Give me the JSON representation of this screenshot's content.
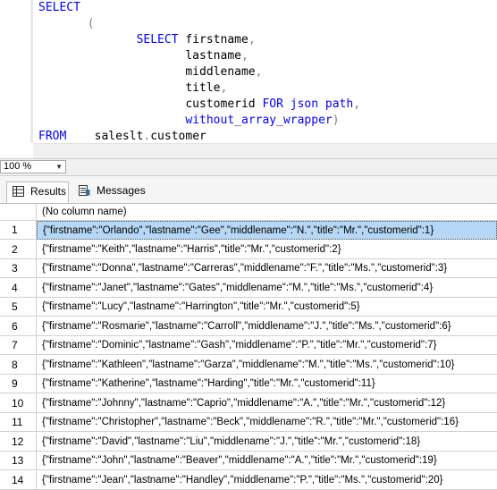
{
  "editor": {
    "lines": [
      [
        {
          "t": "SELECT",
          "c": "kw"
        }
      ],
      [
        {
          "t": "       (",
          "c": "gr"
        }
      ],
      [
        {
          "t": "              ",
          "c": "id"
        },
        {
          "t": "SELECT",
          "c": "kw"
        },
        {
          "t": " firstname",
          "c": "id"
        },
        {
          "t": ",",
          "c": "gr"
        }
      ],
      [
        {
          "t": "                     lastname",
          "c": "id"
        },
        {
          "t": ",",
          "c": "gr"
        }
      ],
      [
        {
          "t": "                     middlename",
          "c": "id"
        },
        {
          "t": ",",
          "c": "gr"
        }
      ],
      [
        {
          "t": "                     title",
          "c": "id"
        },
        {
          "t": ",",
          "c": "gr"
        }
      ],
      [
        {
          "t": "                     customerid ",
          "c": "id"
        },
        {
          "t": "FOR json path",
          "c": "kw"
        },
        {
          "t": ",",
          "c": "gr"
        }
      ],
      [
        {
          "t": "                     ",
          "c": "id"
        },
        {
          "t": "without_array_wrapper",
          "c": "kw"
        },
        {
          "t": ")",
          "c": "gr"
        }
      ],
      [
        {
          "t": "FROM",
          "c": "kw"
        },
        {
          "t": "    saleslt",
          "c": "id"
        },
        {
          "t": ".",
          "c": "gr"
        },
        {
          "t": "customer",
          "c": "id"
        }
      ]
    ]
  },
  "zoom": {
    "value": "100 %"
  },
  "tabs": {
    "results": "Results",
    "messages": "Messages"
  },
  "grid": {
    "column_header": "(No column name)",
    "rows": [
      {
        "n": "1",
        "v": "{\"firstname\":\"Orlando\",\"lastname\":\"Gee\",\"middlename\":\"N.\",\"title\":\"Mr.\",\"customerid\":1}",
        "selected": true
      },
      {
        "n": "2",
        "v": "{\"firstname\":\"Keith\",\"lastname\":\"Harris\",\"title\":\"Mr.\",\"customerid\":2}"
      },
      {
        "n": "3",
        "v": "{\"firstname\":\"Donna\",\"lastname\":\"Carreras\",\"middlename\":\"F.\",\"title\":\"Ms.\",\"customerid\":3}"
      },
      {
        "n": "4",
        "v": "{\"firstname\":\"Janet\",\"lastname\":\"Gates\",\"middlename\":\"M.\",\"title\":\"Ms.\",\"customerid\":4}"
      },
      {
        "n": "5",
        "v": "{\"firstname\":\"Lucy\",\"lastname\":\"Harrington\",\"title\":\"Mr.\",\"customerid\":5}"
      },
      {
        "n": "6",
        "v": "{\"firstname\":\"Rosmarie\",\"lastname\":\"Carroll\",\"middlename\":\"J.\",\"title\":\"Ms.\",\"customerid\":6}"
      },
      {
        "n": "7",
        "v": "{\"firstname\":\"Dominic\",\"lastname\":\"Gash\",\"middlename\":\"P.\",\"title\":\"Mr.\",\"customerid\":7}"
      },
      {
        "n": "8",
        "v": "{\"firstname\":\"Kathleen\",\"lastname\":\"Garza\",\"middlename\":\"M.\",\"title\":\"Ms.\",\"customerid\":10}"
      },
      {
        "n": "9",
        "v": "{\"firstname\":\"Katherine\",\"lastname\":\"Harding\",\"title\":\"Mr.\",\"customerid\":11}"
      },
      {
        "n": "10",
        "v": "{\"firstname\":\"Johnny\",\"lastname\":\"Caprio\",\"middlename\":\"A.\",\"title\":\"Mr.\",\"customerid\":12}"
      },
      {
        "n": "11",
        "v": "{\"firstname\":\"Christopher\",\"lastname\":\"Beck\",\"middlename\":\"R.\",\"title\":\"Mr.\",\"customerid\":16}"
      },
      {
        "n": "12",
        "v": "{\"firstname\":\"David\",\"lastname\":\"Liu\",\"middlename\":\"J.\",\"title\":\"Mr.\",\"customerid\":18}"
      },
      {
        "n": "13",
        "v": "{\"firstname\":\"John\",\"lastname\":\"Beaver\",\"middlename\":\"A.\",\"title\":\"Mr.\",\"customerid\":19}"
      },
      {
        "n": "14",
        "v": "{\"firstname\":\"Jean\",\"lastname\":\"Handley\",\"middlename\":\"P.\",\"title\":\"Ms.\",\"customerid\":20}"
      }
    ]
  }
}
